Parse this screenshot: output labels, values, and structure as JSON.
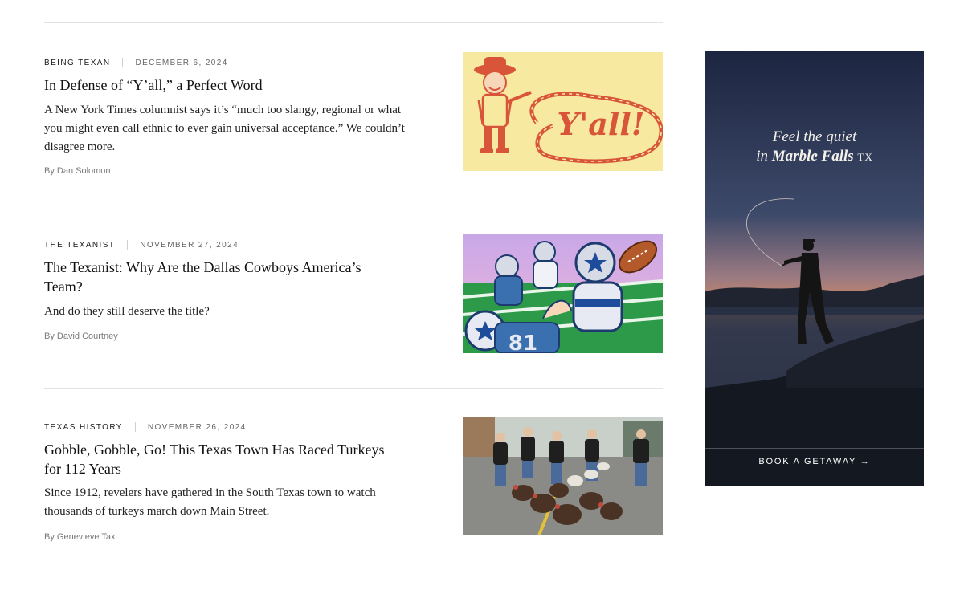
{
  "articles": [
    {
      "category": "BEING TEXAN",
      "date": "DECEMBER 6, 2024",
      "headline": "In Defense of “Y’all,” a Perfect Word",
      "dek": "A New York Times columnist says it’s “much too slangy, regional or what you might even call ethnic to ever gain universal acceptance.” We couldn’t disagree more.",
      "byline": "By Dan Solomon",
      "image_text": "Y'all!"
    },
    {
      "category": "THE TEXANIST",
      "date": "NOVEMBER 27, 2024",
      "headline": "The Texanist: Why Are the Dallas Cowboys America’s Team?",
      "dek": "And do they still deserve the title?",
      "byline": "By David Courtney",
      "image_text": "81"
    },
    {
      "category": "TEXAS HISTORY",
      "date": "NOVEMBER 26, 2024",
      "headline": "Gobble, Gobble, Go! This Texas Town Has Raced Turkeys for 112 Years",
      "dek": "Since 1912, revelers have gathered in the South Texas town to watch thousands of turkeys march down Main Street.",
      "byline": "By Genevieve Tax",
      "image_text": ""
    }
  ],
  "ad": {
    "line1": "Feel the quiet",
    "line2_prefix": "in",
    "brand": "Marble Falls",
    "state": "TX",
    "cta": "BOOK A GETAWAY →"
  },
  "colors": {
    "rule": "#e3e3e3",
    "ad_sky_top": "#1c2540",
    "ad_sunset": "#d98a5c",
    "yall_bg": "#f7e9a0",
    "yall_red": "#d9553a"
  }
}
